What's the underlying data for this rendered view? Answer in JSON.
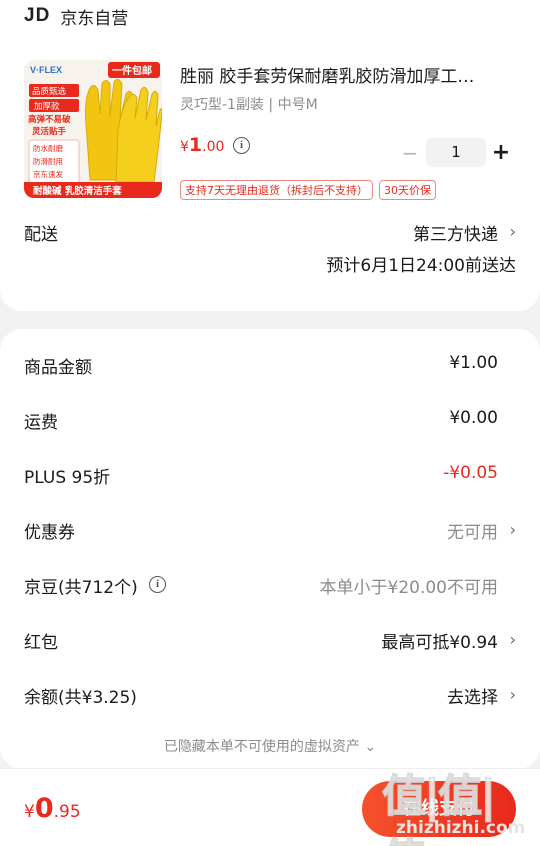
{
  "store": {
    "logo": "JD",
    "name": "京东自营"
  },
  "product": {
    "image": {
      "brand": "V·FLEX",
      "badge": "一件包邮",
      "tags": [
        "品质甄选",
        "加厚款",
        "高弹不易破",
        "灵活贴手"
      ],
      "features": [
        "防水耐磨",
        "防滑耐用",
        "京东速发"
      ],
      "banner": "耐酸碱 乳胶清洁手套"
    },
    "title": "胜丽 胶手套劳保耐磨乳胶防滑加厚工…",
    "spec": "灵巧型-1副装 | 中号M",
    "price": {
      "currency": "¥",
      "integer": "1",
      "decimal": ".00"
    },
    "info_icon": "i",
    "quantity": "1",
    "minus": "−",
    "plus": "+",
    "tags": [
      "支持7天无理由退货（拆封后不支持）",
      "30天价保"
    ]
  },
  "delivery": {
    "label": "配送",
    "method": "第三方快递",
    "eta": "预计6月1日24:00前送达"
  },
  "summary": [
    {
      "label": "商品金额",
      "value": "¥1.00"
    },
    {
      "label": "运费",
      "value": "¥0.00"
    },
    {
      "label": "PLUS 95折",
      "value": "-¥0.05"
    },
    {
      "label": "优惠券",
      "value": "无可用"
    },
    {
      "label": "京豆(共712个)",
      "value": "本单小于¥20.00不可用"
    },
    {
      "label": "红包",
      "value": "最高可抵¥0.94"
    },
    {
      "label": "余额(共¥3.25)",
      "value": "去选择"
    }
  ],
  "hidden_tip": "已隐藏本单不可使用的虚拟资产",
  "footer": {
    "total": {
      "currency": "¥",
      "integer": "0",
      "decimal": ".95"
    },
    "pay_label": "在线支付",
    "watermark": {
      "big": "值|值|值",
      "small": "zhizhizhi.com"
    }
  },
  "colors": {
    "accent": "#e8291c",
    "muted": "#8c8c8c",
    "glove": "#f2c511"
  }
}
